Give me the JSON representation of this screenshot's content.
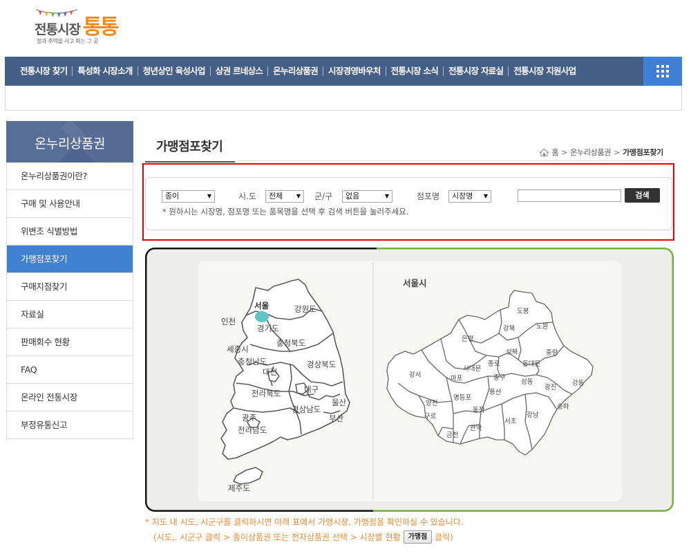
{
  "logo": {
    "name_part1": "전통시장",
    "name_part2": "통통",
    "tagline": "정과 추억을 사고 파는 그 곳"
  },
  "gnb": {
    "items": [
      "전통시장 찾기",
      "특성화 시장소개",
      "청년상인 육성사업",
      "상권 르네상스",
      "온누리상품권",
      "시장경영바우처",
      "전통시장 소식",
      "전통시장 자료실",
      "전통시장 지원사업"
    ]
  },
  "lnb": {
    "title": "온누리상품권",
    "items": [
      {
        "label": "온누리상품권이란?",
        "active": false
      },
      {
        "label": "구매 및 사용안내",
        "active": false
      },
      {
        "label": "위변조 식별방법",
        "active": false
      },
      {
        "label": "가맹점포찾기",
        "active": true
      },
      {
        "label": "구매지점찾기",
        "active": false
      },
      {
        "label": "자료실",
        "active": false
      },
      {
        "label": "판매회수 현황",
        "active": false
      },
      {
        "label": "FAQ",
        "active": false
      },
      {
        "label": "온라인 전통시장",
        "active": false
      },
      {
        "label": "부정유통신고",
        "active": false
      }
    ]
  },
  "page": {
    "title": "가맹점포찾기",
    "breadcrumb": [
      "홈",
      "온누리상품권",
      "가맹점포찾기"
    ]
  },
  "search": {
    "type_value": "종이",
    "sido_label": "시.도",
    "sido_value": "전체",
    "gungu_label": "군/구",
    "gungu_value": "없음",
    "store_label": "점포명",
    "store_value": "시장명",
    "keyword_value": "",
    "button_label": "검색",
    "hint": "* 원하시는 시장명, 점포명 또는 품목명을 선택 후 검색 버튼을 눌러주세요."
  },
  "map": {
    "korea_regions": [
      "서울",
      "인천",
      "강원도",
      "경기도",
      "세종시",
      "충청북도",
      "충청남도",
      "대전",
      "경상북도",
      "전라북도",
      "대구",
      "울산",
      "경상남도",
      "광주",
      "부산",
      "전라남도",
      "제주도"
    ],
    "seoul_title": "서울시",
    "seoul_districts": [
      "도봉",
      "강북",
      "노원",
      "은평",
      "성북",
      "중랑",
      "종로",
      "동대문",
      "서대문",
      "강서",
      "마포",
      "중구",
      "성동",
      "광진",
      "강동",
      "용산",
      "양천",
      "영등포",
      "동작",
      "서초",
      "강남",
      "송파",
      "구로",
      "관악",
      "금천"
    ]
  },
  "notes": {
    "line1": "* 지도 내 시도, 시군구를 클릭하시면 아래 표에서 가맹시장, 가맹점을 확인하실 수 있습니다.",
    "line2_pre": "(시도,. 시군구 클릭 > 종이상품권 또는 전자상품권 선택 > 시장별 현황",
    "line2_button": "가맹점",
    "line2_post": "클릭)"
  },
  "colors": {
    "gnb_bg": "#465f87",
    "lnb_title_bg": "#4d6590",
    "lnb_active_bg": "#3f82cf",
    "highlight_border": "#e0000a",
    "note_color": "#f08a32",
    "map_border_green": "#6fb53a",
    "seoul_marker": "#5fc7c3"
  }
}
